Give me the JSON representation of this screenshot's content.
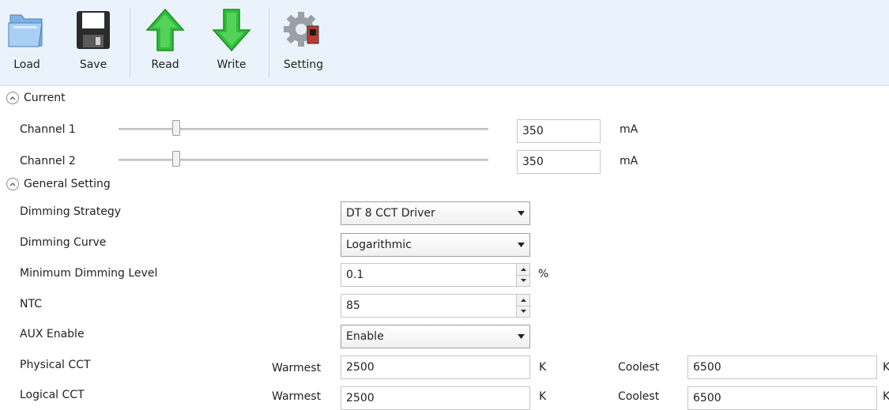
{
  "toolbar": {
    "load": "Load",
    "save": "Save",
    "read": "Read",
    "write": "Write",
    "setting": "Setting"
  },
  "current": {
    "title": "Current",
    "channels": [
      {
        "label": "Channel 1",
        "value": "350",
        "unit": "mA",
        "slider_fraction": 0.155
      },
      {
        "label": "Channel 2",
        "value": "350",
        "unit": "mA",
        "slider_fraction": 0.155
      }
    ]
  },
  "general": {
    "title": "General Setting",
    "dimming_strategy": {
      "label": "Dimming Strategy",
      "value": "DT 8 CCT Driver"
    },
    "dimming_curve": {
      "label": "Dimming Curve",
      "value": "Logarithmic"
    },
    "min_dimming": {
      "label": "Minimum Dimming Level",
      "value": "0.1",
      "unit": "%"
    },
    "ntc": {
      "label": "NTC",
      "value": "85"
    },
    "aux": {
      "label": "AUX Enable",
      "value": "Enable"
    },
    "physical_cct": {
      "label": "Physical CCT",
      "warmest_label": "Warmest",
      "warmest": "2500",
      "warmest_unit": "K",
      "coolest_label": "Coolest",
      "coolest": "6500",
      "coolest_unit": "K"
    },
    "logical_cct": {
      "label": "Logical CCT",
      "warmest_label": "Warmest",
      "warmest": "2500",
      "warmest_unit": "K",
      "coolest_label": "Coolest",
      "coolest": "6500",
      "coolest_unit": "K"
    }
  }
}
